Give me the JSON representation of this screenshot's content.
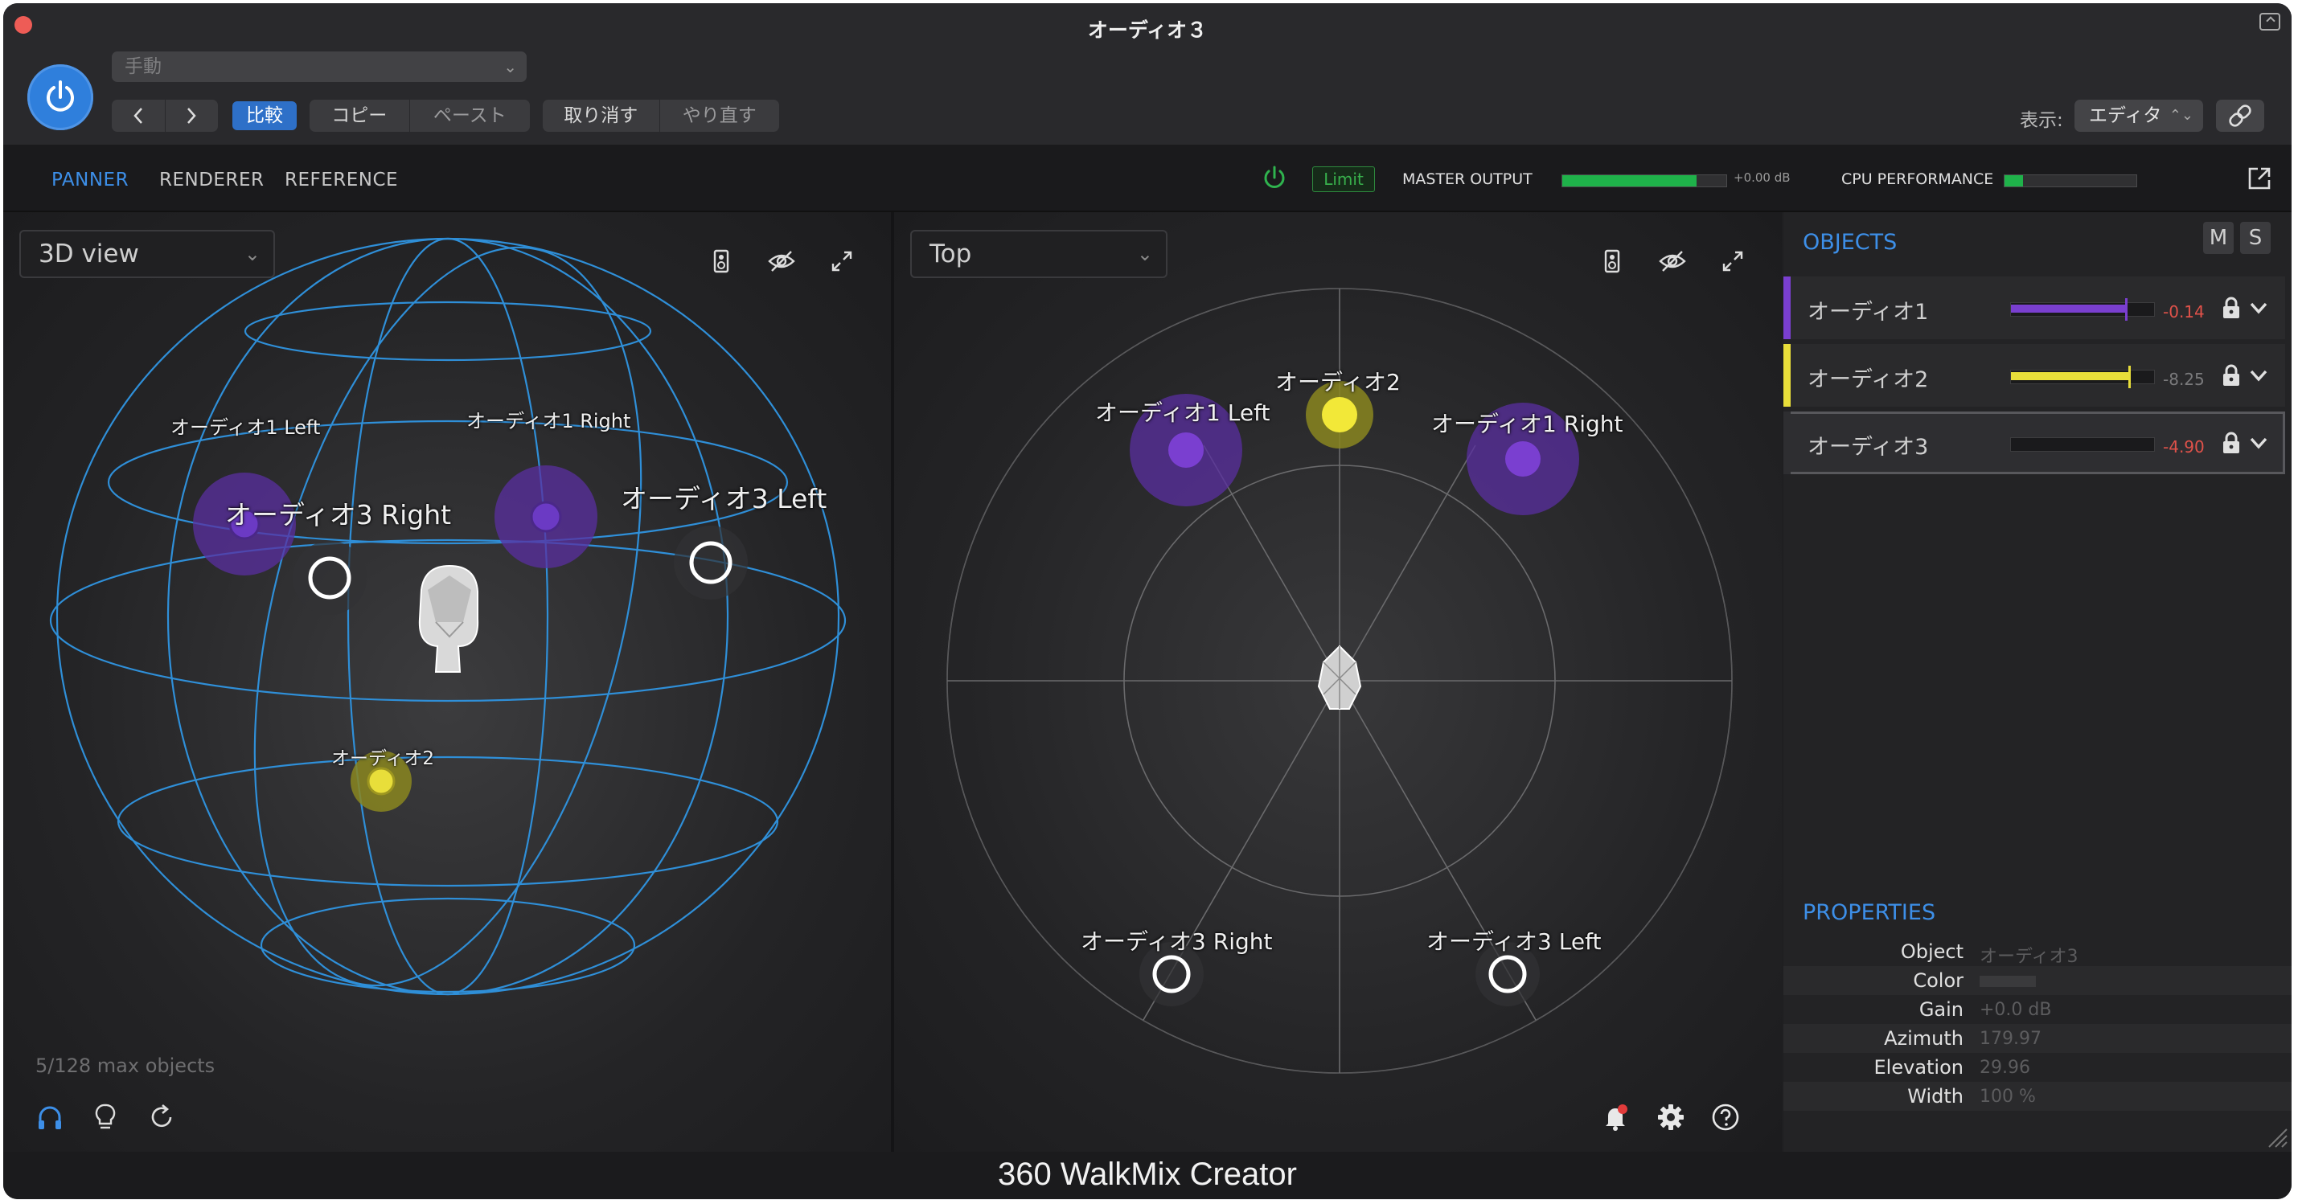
{
  "window": {
    "title": "オーディオ３"
  },
  "header": {
    "preset": "手動",
    "compare": "比較",
    "copy": "コピー",
    "paste": "ペースト",
    "undo": "取り消す",
    "redo": "やり直す",
    "display_label": "表示:",
    "display_value": "エディタ"
  },
  "tabs": {
    "panner": "PANNER",
    "renderer": "RENDERER",
    "reference": "REFERENCE"
  },
  "meters": {
    "limit": "Limit",
    "master_output": "MASTER OUTPUT",
    "master_db": "+0.00 dB",
    "master_level": 0.82,
    "cpu_performance": "CPU PERFORMANCE",
    "cpu_level": 0.14
  },
  "view3d": {
    "mode": "3D view",
    "max_objects": "5/128 max objects",
    "labels": {
      "a1l": "オーディオ1 Left",
      "a1r": "オーディオ1 Right",
      "a3r": "オーディオ3 Right",
      "a3l": "オーディオ3 Left",
      "a2": "オーディオ2"
    }
  },
  "viewtop": {
    "mode": "Top",
    "labels": {
      "a1l": "オーディオ1 Left",
      "a2": "オーディオ2",
      "a1r": "オーディオ1 Right",
      "a3r": "オーディオ3 Right",
      "a3l": "オーディオ3 Left"
    }
  },
  "objects": {
    "title": "OBJECTS",
    "mute": "M",
    "solo": "S",
    "items": [
      {
        "name": "オーディオ1",
        "db": "-0.14",
        "color": "#7a3fd0",
        "level": 0.8,
        "db_color": "#e0524a"
      },
      {
        "name": "オーディオ2",
        "db": "-8.25",
        "color": "#e8de3a",
        "level": 0.82,
        "db_color": "#7a7a7c"
      },
      {
        "name": "オーディオ3",
        "db": "-4.90",
        "color": "#5a5a5c",
        "level": 0.0,
        "db_color": "#e0524a"
      }
    ]
  },
  "properties": {
    "title": "PROPERTIES",
    "object_label": "Object",
    "object_value": "オーディオ3",
    "color_label": "Color",
    "gain_label": "Gain",
    "gain_value": "+0.0 dB",
    "azimuth_label": "Azimuth",
    "azimuth_value": "179.97",
    "elevation_label": "Elevation",
    "elevation_value": "29.96",
    "width_label": "Width",
    "width_value": "100 %"
  },
  "footer": {
    "title": "360 WalkMix Creator"
  },
  "colors": {
    "accent": "#3d8fe8",
    "purple": "#7a3fd0",
    "yellow": "#e8de3a",
    "sphere": "#2f8fd8",
    "meter_green": "#1fb24a"
  }
}
